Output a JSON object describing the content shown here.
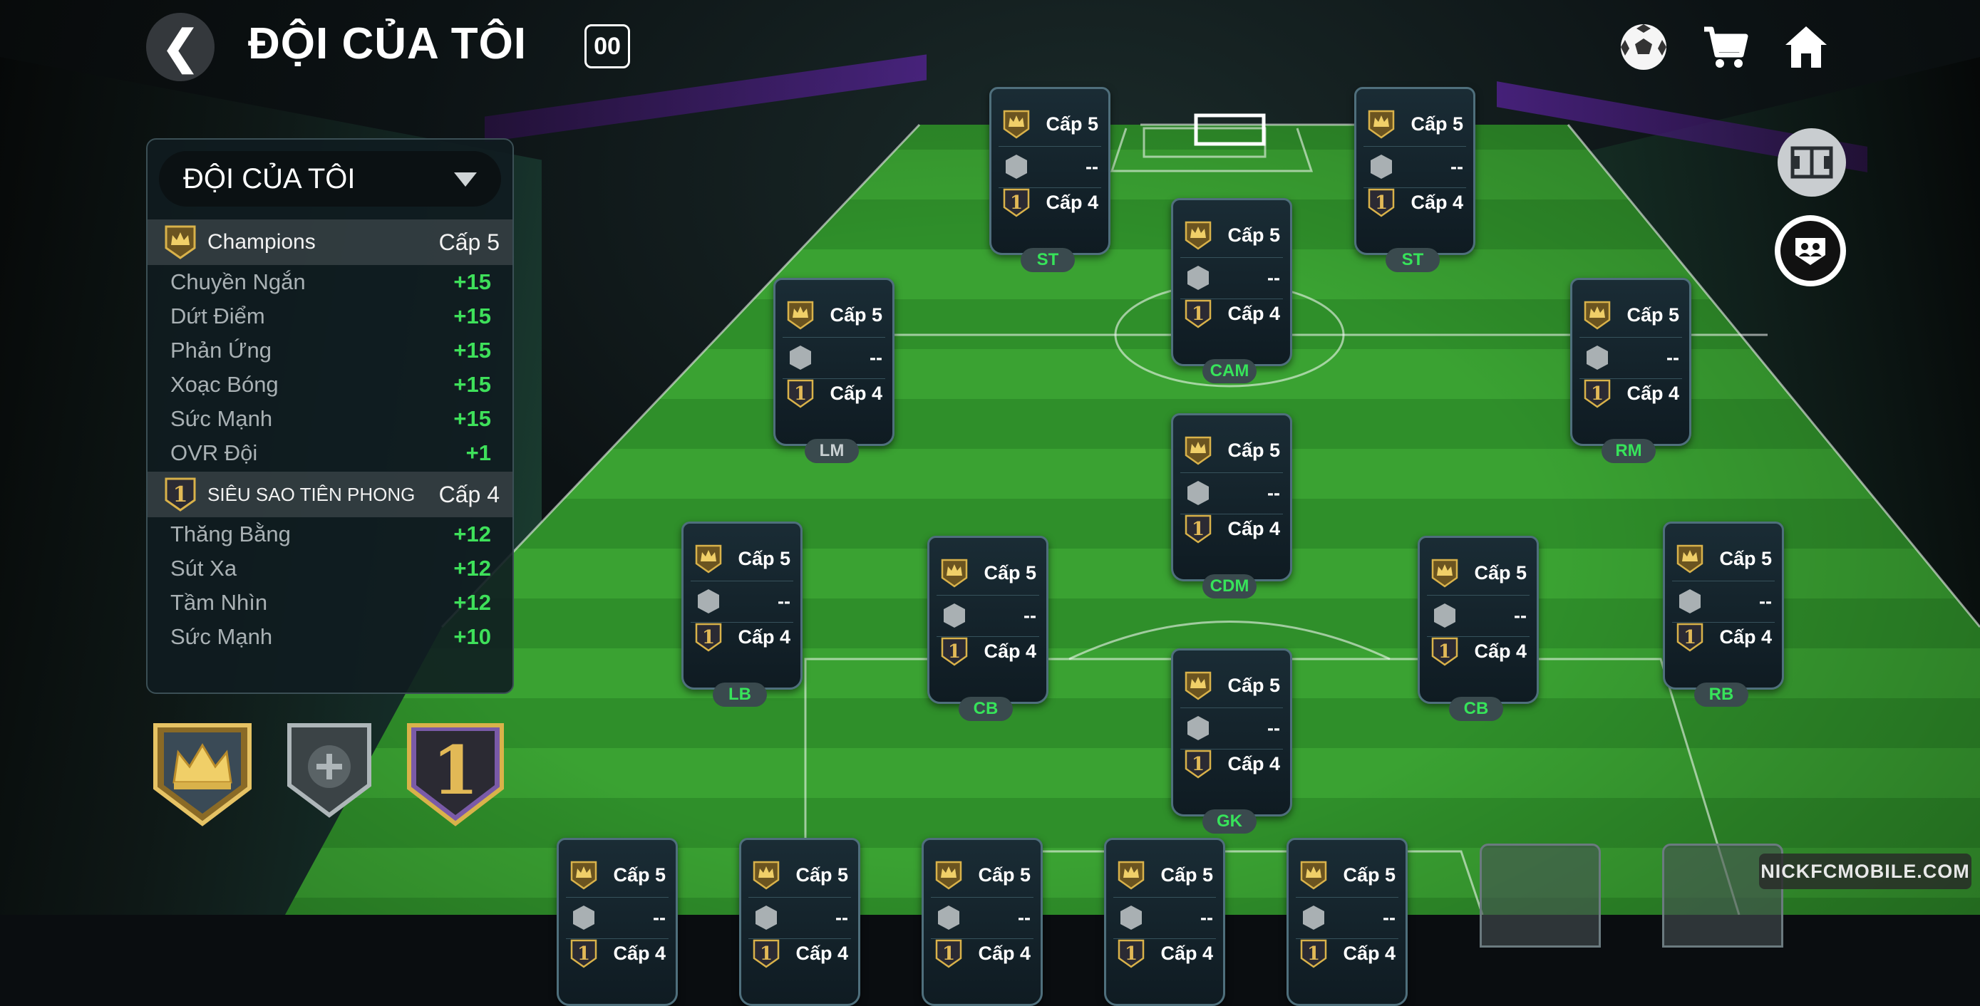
{
  "header": {
    "back_icon": "chevron-left-icon",
    "title": "ĐỘI CỦA TÔI",
    "badge": "00"
  },
  "top_icons": [
    "football-icon",
    "shopping-cart-icon",
    "home-icon"
  ],
  "side_buttons": [
    "formation-pitch-icon",
    "squad-group-icon"
  ],
  "panel": {
    "dropdown_label": "ĐỘI CỦA TÔI",
    "groups": [
      {
        "name": "Champions",
        "level": "Cấp 5",
        "icon": "crown-badge-icon",
        "stats": [
          {
            "name": "Chuyền Ngắn",
            "value": "+15"
          },
          {
            "name": "Dứt Điểm",
            "value": "+15"
          },
          {
            "name": "Phản Ứng",
            "value": "+15"
          },
          {
            "name": "Xoạc Bóng",
            "value": "+15"
          },
          {
            "name": "Sức Mạnh",
            "value": "+15"
          },
          {
            "name": "OVR Đội",
            "value": "+1"
          }
        ]
      },
      {
        "name": "SIÊU SAO TIÊN PHONG",
        "level": "Cấp 4",
        "icon": "number-one-badge-icon",
        "stats": [
          {
            "name": "Thăng Bằng",
            "value": "+12"
          },
          {
            "name": "Sút Xa",
            "value": "+12"
          },
          {
            "name": "Tầm Nhìn",
            "value": "+12"
          },
          {
            "name": "Sức Mạnh",
            "value": "+10"
          }
        ]
      }
    ]
  },
  "bottom_badges": [
    "crown-badge-icon",
    "add-badge-icon",
    "number-one-badge-icon"
  ],
  "card_rows": {
    "crown_level": "Cấp 5",
    "empty_value": "--",
    "one_level": "Cấp 4"
  },
  "players": [
    {
      "pos": "ST"
    },
    {
      "pos": "ST"
    },
    {
      "pos": "CAM"
    },
    {
      "pos": "LM"
    },
    {
      "pos": "RM"
    },
    {
      "pos": "CDM"
    },
    {
      "pos": "LB"
    },
    {
      "pos": "CB"
    },
    {
      "pos": "CB"
    },
    {
      "pos": "RB"
    },
    {
      "pos": "GK"
    }
  ],
  "bench_count": 5,
  "watermark": "NICKFCMOBILE.COM",
  "colors": {
    "accent_green": "#3ee05a",
    "pitch_green": "#3aa232",
    "gold": "#d9b24a"
  }
}
